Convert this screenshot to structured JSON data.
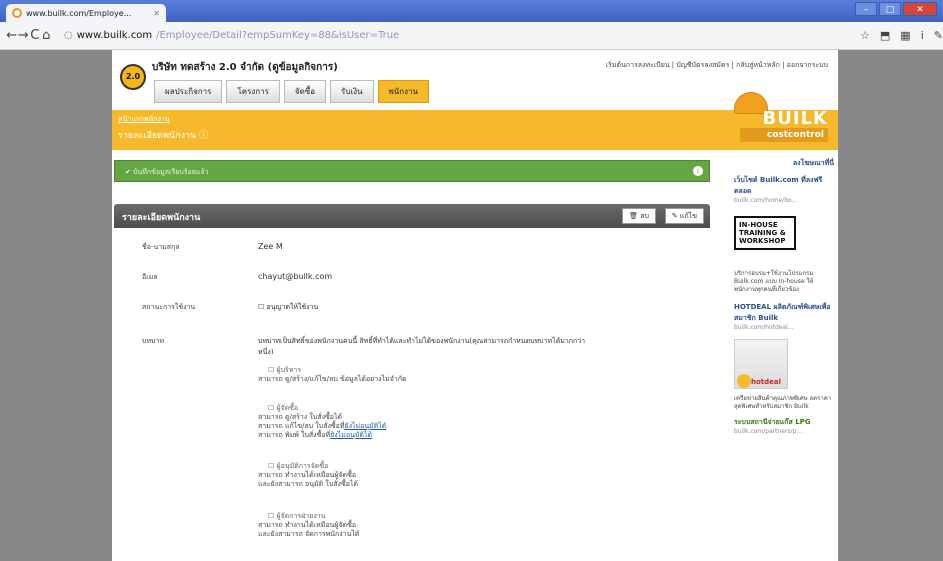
{
  "browser": {
    "tab_title": "www.builk.com/Employe...",
    "url_host": "www.builk.com",
    "url_path": "/Employee/Detail?empSumKey=88&isUser=True"
  },
  "header": {
    "logo_text": "2.0",
    "company_name": "บริษัท ทดสร้าง 2.0 จำกัด (ดูข้อมูลกิจการ)",
    "top_links": "เริ่มต้นการลงทะเบียน | บัญชีบัตรลงสมัคร | กลับสู่หน้าหลัก | ออกจากระบบ",
    "menu": [
      "ผลประกิจการ",
      "โครงการ",
      "จัดซื้อ",
      "รับเงิน",
      "พนักงาน"
    ]
  },
  "subheader": {
    "breadcrumb": "หน้าแรกพนักงาน",
    "title": "รายละเอียดพนักงาน ⓘ"
  },
  "brand": {
    "word": "BUILK",
    "tagline": "costcontrol"
  },
  "alert": {
    "message": "บันทึกข้อมูลเรียบร้อยแล้ว",
    "icon": "i"
  },
  "panel": {
    "title": "รายละเอียดพนักงาน",
    "delete_label": "🗑 ลบ",
    "edit_label": "✎ แก้ไข"
  },
  "employee": {
    "name_label": "ชื่อ-นามสกุล",
    "name_value": "Zee M",
    "email_label": "อีเมล",
    "email_value": "chayut@builk.com",
    "status_label": "สถานะการใช้งาน",
    "status_value": "อนุญาตให้ใช้งาน",
    "role_label": "บทบาท",
    "role_value": "บทบาทเป็นสิทธิ์ของพนักงานคนนี้ สิทธิ์ที่ทำได้และทำไม่ได้ของพนักงาน(คุณสามารถกำหนดบทบาทได้มากกว่าหนึ่ง)"
  },
  "roles": [
    {
      "name": "ผู้บริหาร",
      "line1": "สามารถ ดู/สร้าง/แก้ไข/ลบ ข้อมูลได้อย่างไม่จำกัด",
      "line2": "",
      "line3": "",
      "link": ""
    },
    {
      "name": "ผู้จัดซื้อ",
      "line1": "สามารถ ดู/สร้าง ใบสั่งซื้อได้",
      "line2": "สามารถ แก้ไข/ลบ ใบสั่งซื้อที่",
      "line3": "สามารถ พิมพ์ ใบสั่งซื้อที่",
      "link": "ยังไม่อนุมัติได้"
    },
    {
      "name": "ผู้อนุมัติการจัดซื้อ",
      "line1": "สามารถ ทำงานได้เหมือนผู้จัดซื้อ",
      "line2": "และยังสามารถ อนุมัติ ใบสั่งซื้อได้",
      "line3": "",
      "link": ""
    },
    {
      "name": "ผู้จัดการฝ่ายงาน",
      "line1": "สามารถ ทำงานได้เหมือนผู้จัดซื้อ",
      "line2": "และยังสามารถ จัดการพนักงานได้",
      "line3": "",
      "link": ""
    }
  ],
  "sidebar": {
    "heading": "ลงโฆษณาที่นี่",
    "promo1_title": "เว็บไซต์ Builk.com ที่ลงฟรีตลอด",
    "promo1_link": "builk.com/home/bo...",
    "training_text": "IN-HOUSE TRAINING & WORKSHOP",
    "training_desc": "บริการอบรม+ใช้งานโปรแกรม Builk.com แบบ In-house ให้พนักงานทุกคนที่เกี่ยวข้อง",
    "hotdeal_title": "HOTDEAL ผลิตภัณฑ์พิเศษเพื่อสมาชิก Builk",
    "hotdeal_link": "builk.com/hotdeal...",
    "hotdeal_badge": "hotdeal",
    "hotdeal_desc": "เครือข่ายสินค้าคุณภาพพิเศษ ลดราคาสุดพิเศษสำหรับสมาชิก Builk",
    "lpg_title": "ระบบสถานีจ่ายแก๊ส LPG",
    "lpg_link": "builk.com/partners/p..."
  },
  "colors": {
    "accent": "#f7b92c",
    "success": "#63a643",
    "panel_header": "#555555"
  }
}
